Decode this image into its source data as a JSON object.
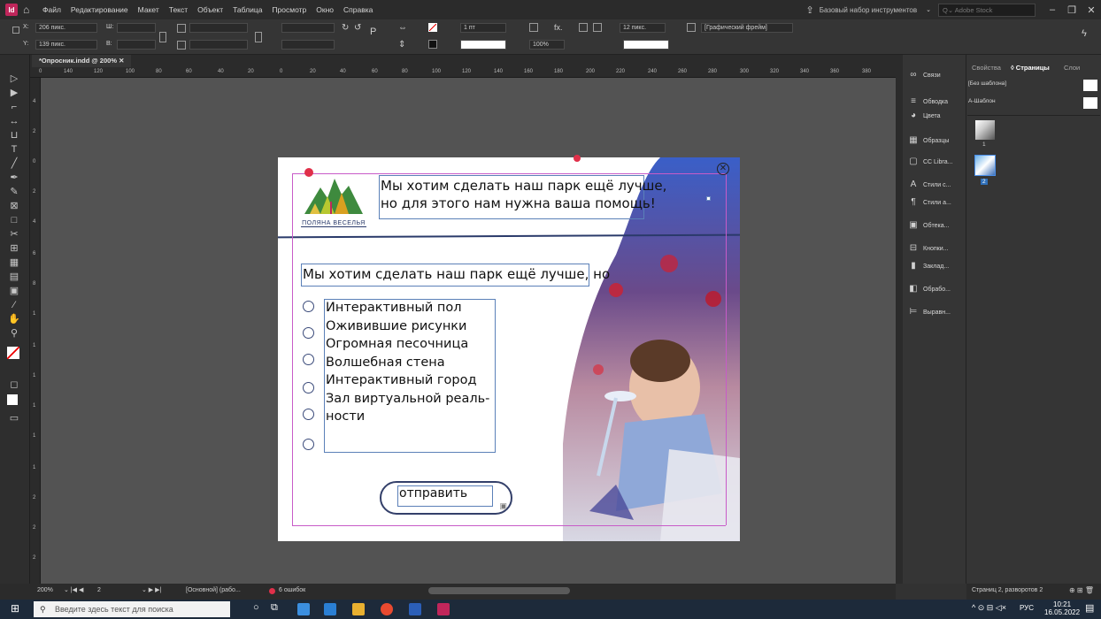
{
  "menu": {
    "app_logo": "Id",
    "items": [
      "Файл",
      "Редактирование",
      "Макет",
      "Текст",
      "Объект",
      "Таблица",
      "Просмотр",
      "Окно",
      "Справка"
    ],
    "workspace": "Базовый набор инструментов",
    "stock_placeholder": "Adobe Stock"
  },
  "control": {
    "x_label": "X:",
    "x_value": "206 пикс.",
    "y_label": "Y:",
    "y_value": "139 пикс.",
    "w_label": "Ш:",
    "h_label": "В:",
    "stroke_weight": "1 пт",
    "opacity": "100%",
    "gutter": "12 пикс.",
    "frame_type": "[Графический фрейм]"
  },
  "document": {
    "tab_title": "*Опросник.indd @ 200%",
    "ruler_h": [
      "0",
      "140",
      "120",
      "100",
      "80",
      "60",
      "40",
      "20",
      "0",
      "20",
      "40",
      "60",
      "80",
      "100",
      "120",
      "140",
      "160",
      "180",
      "200",
      "220",
      "240",
      "260",
      "280",
      "300",
      "320",
      "340",
      "360",
      "380"
    ],
    "ruler_v": [
      "4",
      "2",
      "0",
      "2",
      "4",
      "6",
      "8",
      "1",
      "1",
      "1",
      "1",
      "1",
      "1",
      "2",
      "2",
      "2",
      "2"
    ]
  },
  "page": {
    "logo_text": "ПОЛЯНА ВЕСЕЛЬЯ",
    "header_line1": "Мы хотим сделать наш парк ещё лучше,",
    "header_line2": "но для этого нам нужна ваша помощь!",
    "question": "Мы хотим сделать наш парк ещё лучше, но",
    "options": [
      "Интерактивный пол",
      "Оживившие рисунки",
      "Огромная песочница",
      "Волшебная стена",
      "Интерактивный город",
      "Зал виртуальной реаль-",
      "ности"
    ],
    "submit_label": "отправить"
  },
  "panels": {
    "items": [
      "Связи",
      "Обводка",
      "Цвета",
      "Образцы",
      "CC Libra...",
      "Стили с...",
      "Стили а...",
      "Обтека...",
      "Кнопки...",
      "Заклад...",
      "Обрабо...",
      "Выравн..."
    ]
  },
  "pages_panel": {
    "tabs": [
      "Свойства",
      "Страницы",
      "Слои"
    ],
    "none_master": "[Без шаблона]",
    "a_master": "А-Шаблон",
    "page1": "1",
    "page2": "2",
    "footer": "Страниц 2, разворотов 2"
  },
  "status": {
    "zoom": "200%",
    "page": "2",
    "mode": "[Основной] (рабо...",
    "errors": "6 ошибок"
  },
  "taskbar": {
    "search_placeholder": "Введите здесь текст для поиска",
    "lang": "РУС",
    "time": "10:21",
    "date": "16.05.2022"
  },
  "colors": {
    "accent": "#2f6fb8",
    "guide": "#c85bc8",
    "indesign": "#c0265b"
  }
}
